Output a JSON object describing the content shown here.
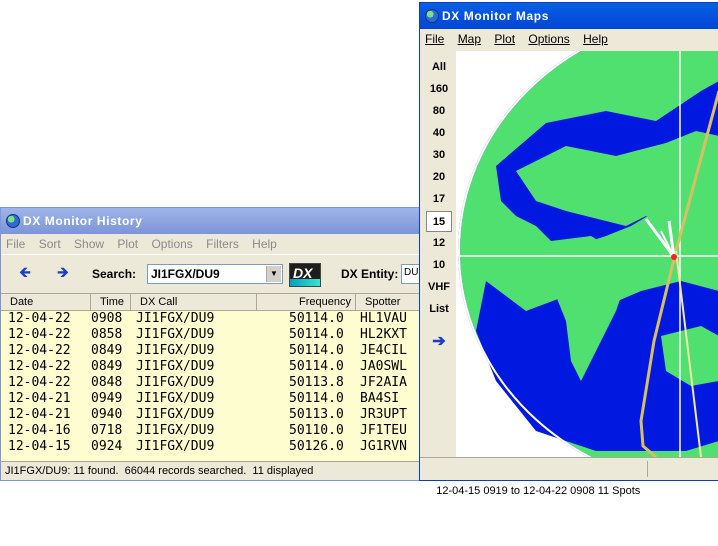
{
  "history": {
    "title": "DX Monitor History",
    "menu": [
      "File",
      "Sort",
      "Show",
      "Plot",
      "Options",
      "Filters",
      "Help"
    ],
    "toolbar": {
      "back_icon": "arrow-left-icon",
      "forward_icon": "arrow-right-icon",
      "search_label": "Search:",
      "search_value": "JI1FGX/DU9",
      "entity_label": "DX Entity:",
      "entity_value": "DU",
      "logo_text": "DX"
    },
    "columns": [
      "Date",
      "Time",
      "DX Call",
      "Frequency",
      "Spotter"
    ],
    "rows": [
      {
        "date": "12-04-22",
        "time": "0908",
        "call": "JI1FGX/DU9",
        "freq": "50114.0",
        "spotter": "HL1VAU"
      },
      {
        "date": "12-04-22",
        "time": "0858",
        "call": "JI1FGX/DU9",
        "freq": "50114.0",
        "spotter": "HL2KXT"
      },
      {
        "date": "12-04-22",
        "time": "0849",
        "call": "JI1FGX/DU9",
        "freq": "50114.0",
        "spotter": "JE4CIL"
      },
      {
        "date": "12-04-22",
        "time": "0849",
        "call": "JI1FGX/DU9",
        "freq": "50114.0",
        "spotter": "JA0SWL"
      },
      {
        "date": "12-04-22",
        "time": "0848",
        "call": "JI1FGX/DU9",
        "freq": "50113.8",
        "spotter": "JF2AIA"
      },
      {
        "date": "12-04-21",
        "time": "0949",
        "call": "JI1FGX/DU9",
        "freq": "50114.0",
        "spotter": "BA4SI"
      },
      {
        "date": "12-04-21",
        "time": "0940",
        "call": "JI1FGX/DU9",
        "freq": "50113.0",
        "spotter": "JR3UPT"
      },
      {
        "date": "12-04-16",
        "time": "0718",
        "call": "JI1FGX/DU9",
        "freq": "50110.0",
        "spotter": "JF1TEU"
      },
      {
        "date": "12-04-15",
        "time": "0924",
        "call": "JI1FGX/DU9",
        "freq": "50126.0",
        "spotter": "JG1RVN"
      }
    ],
    "status": "JI1FGX/DU9: 11 found.  66044 records searched.  11 displayed"
  },
  "maps": {
    "title": "DX Monitor Maps",
    "menu": [
      "File",
      "Map",
      "Plot",
      "Options",
      "Help"
    ],
    "bands": [
      "All",
      "160",
      "80",
      "40",
      "30",
      "20",
      "17",
      "15",
      "12",
      "10",
      "VHF",
      "List"
    ],
    "selected_band": "15",
    "go_icon": "arrow-right-icon",
    "status": "12-04-15 0919 to 12-04-22 0908 11 Spots",
    "colors": {
      "ocean": "#0018e0",
      "land": "#50e070",
      "path": "#d8c060"
    }
  }
}
